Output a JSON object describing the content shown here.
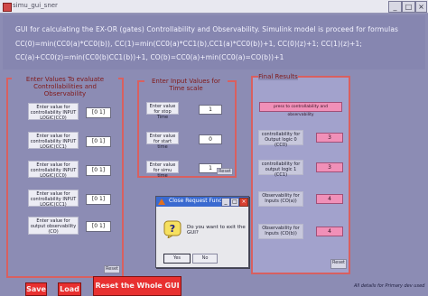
{
  "window": {
    "title": "simu_gui_sner",
    "minimize": "_",
    "maximize": "□",
    "close": "×"
  },
  "banner": {
    "lines": [
      "GUI for calculating the EX-OR (gates) Controllability and Observability. Simulink model is proceed for formulas",
      "CC(0)=min(CC0(a)*CC0(b)), CC(1)=min(CC0(a)*CC1(b),CC1(a)*CC0(b))+1, CC(0)(z)+1; CC(1)(z)+1;",
      "CC(a)+CC0(z)=min(CC0(b)CC1(b))+1, CO(b)=CC0(a)+min(CC0(a)=CO(b))+1"
    ]
  },
  "left_panel": {
    "title": "Enter Values To evaluate Controllabilities and Observability",
    "rows": [
      {
        "label": "Enter value for controllability INPUT LOGIC(CC0)",
        "value": "[0 1]"
      },
      {
        "label": "Enter value for controllability INPUT LOGIC(CC1)",
        "value": "[0 1]"
      },
      {
        "label": "Enter value for controllability INPUT LOGIC(CC0)",
        "value": "[0 1]"
      },
      {
        "label": "Enter value for controllability INPUT LOGIC(CC1)",
        "value": "[0 1]"
      },
      {
        "label": "Enter value for output observability (CO)",
        "value": "[0 1]"
      }
    ],
    "reset": "Reset"
  },
  "mid_panel": {
    "title": "Enter Input Values for Time scale",
    "rows": [
      {
        "label": "Enter value for stop Time",
        "value": "1"
      },
      {
        "label": "Enter value for start time",
        "value": "0"
      },
      {
        "label": "Enter value for simu time",
        "value": "1"
      }
    ],
    "reset": "Reset"
  },
  "right_panel": {
    "title": "Final Results",
    "action": "press to controllability and observability",
    "rows": [
      {
        "label": "controllability for Output logic 0 (CC0)",
        "value": "3"
      },
      {
        "label": "controllability for output logic 1 (CC1)",
        "value": "3"
      },
      {
        "label": "Observability for Inputs (CO(a))",
        "value": "4"
      },
      {
        "label": "Observability for Inputs (CO(b))",
        "value": "4"
      }
    ],
    "reset": "Reset"
  },
  "bottom": {
    "save": "Save",
    "load": "Load",
    "reset_all": "Reset the Whole GUI",
    "credit": "All details for Primary dev used"
  },
  "dialog": {
    "title": "Close Request Function",
    "icon": "question-icon",
    "message": "Do you want to exit the GUI?",
    "yes": "Yes",
    "no": "No"
  },
  "colors": {
    "panel_border": "#d86060",
    "accent_button": "#f090b8",
    "red_button": "#e83030",
    "background": "#8c8cb4"
  }
}
